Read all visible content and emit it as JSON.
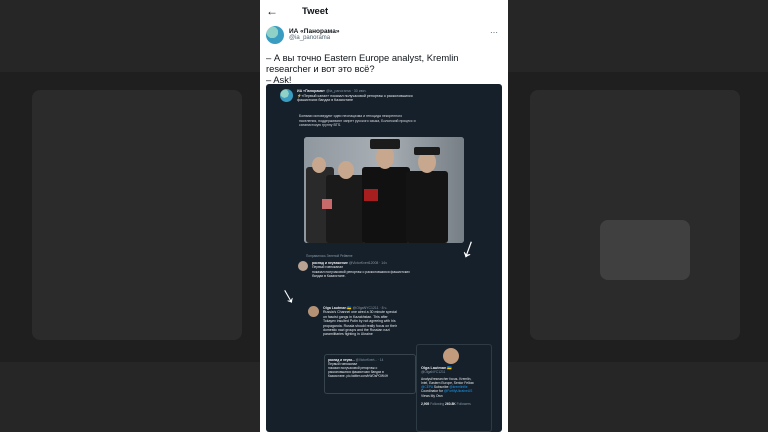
{
  "header": {
    "back_icon": "back-arrow-icon",
    "title": "Tweet"
  },
  "author": {
    "name": "ИА «Панорама»",
    "handle": "@ia_panorama",
    "more_icon": "more-dots-icon"
  },
  "tweet_lines": [
    "– А вы точно Eastern Europe analyst, Kremlin",
    "researcher и вот это всё?",
    "– Ask!"
  ],
  "screenshot": {
    "quoted": {
      "name": "ИА «Панорама»",
      "handle": "@ia_panorama · 30 июн.",
      "line1": "⚡«Первый канал» показал получасовой репортаж о расколовшихся",
      "line2": "фашистских бандах в Казахстане",
      "body": [
        "Боевики исповедуют идеи неонацизма и геноцида некоренного",
        "населения, поддерживают запрет русского языка, Болонский процесс и",
        "сатанистскую группу BTS."
      ]
    },
    "reply1": {
      "liked": "Понравилось Зеленой Рейвене",
      "name": "распад и неуважение",
      "handle": "@VictorKvert12008 · 14ч",
      "lines": [
        "Первый говноканал",
        "показал получасовой репортаж о расколовшихся фашистских",
        "бандах в Казахстане."
      ]
    },
    "reply2": {
      "name": "Olga Lautman 🇺🇦",
      "handle": "@OlgaNYC1211 · 8 ч.",
      "lines": [
        "Russia's Channel one aired a 30 minute special",
        "on fascist gangs in Kazakhstan. This after",
        "Tokayev insulted Putin by not agreeing with his",
        "propaganda. Russia should really focus on their",
        "domestic nazi groups and the Russian nazi",
        "paramilitaries fighting in Ukraine"
      ]
    },
    "inner_card": {
      "header": "распад и неува...",
      "handle": "@VictorKvert... · 14",
      "lines": [
        "Первый говноканал",
        "показал получасовой репортаж о",
        "расколовшихся фашистских бандах в",
        "Казахстане.  pic.twitter.com/bWOsPOW4H"
      ]
    },
    "hovercard": {
      "name": "Olga Lautman 🇺🇦",
      "handle": "@OlgaNYC1211",
      "bio_lines": [
        "Analyst/researcher focus- Kremlin,",
        "Intel, Eastern Europe, Senior Fellow"
      ],
      "bio_link": "@CEPA",
      "bio_after_link": " Subscribe",
      "bio_link2": "@kremlinfile",
      "bio_coord": "Coordinator for",
      "bio_link3": "@FortifyUkraineUS",
      "bio_end": "Views My Own",
      "following_count": "2,905",
      "following_label": "Following",
      "followers_count": "260.8K",
      "followers_label": "Followers"
    }
  }
}
